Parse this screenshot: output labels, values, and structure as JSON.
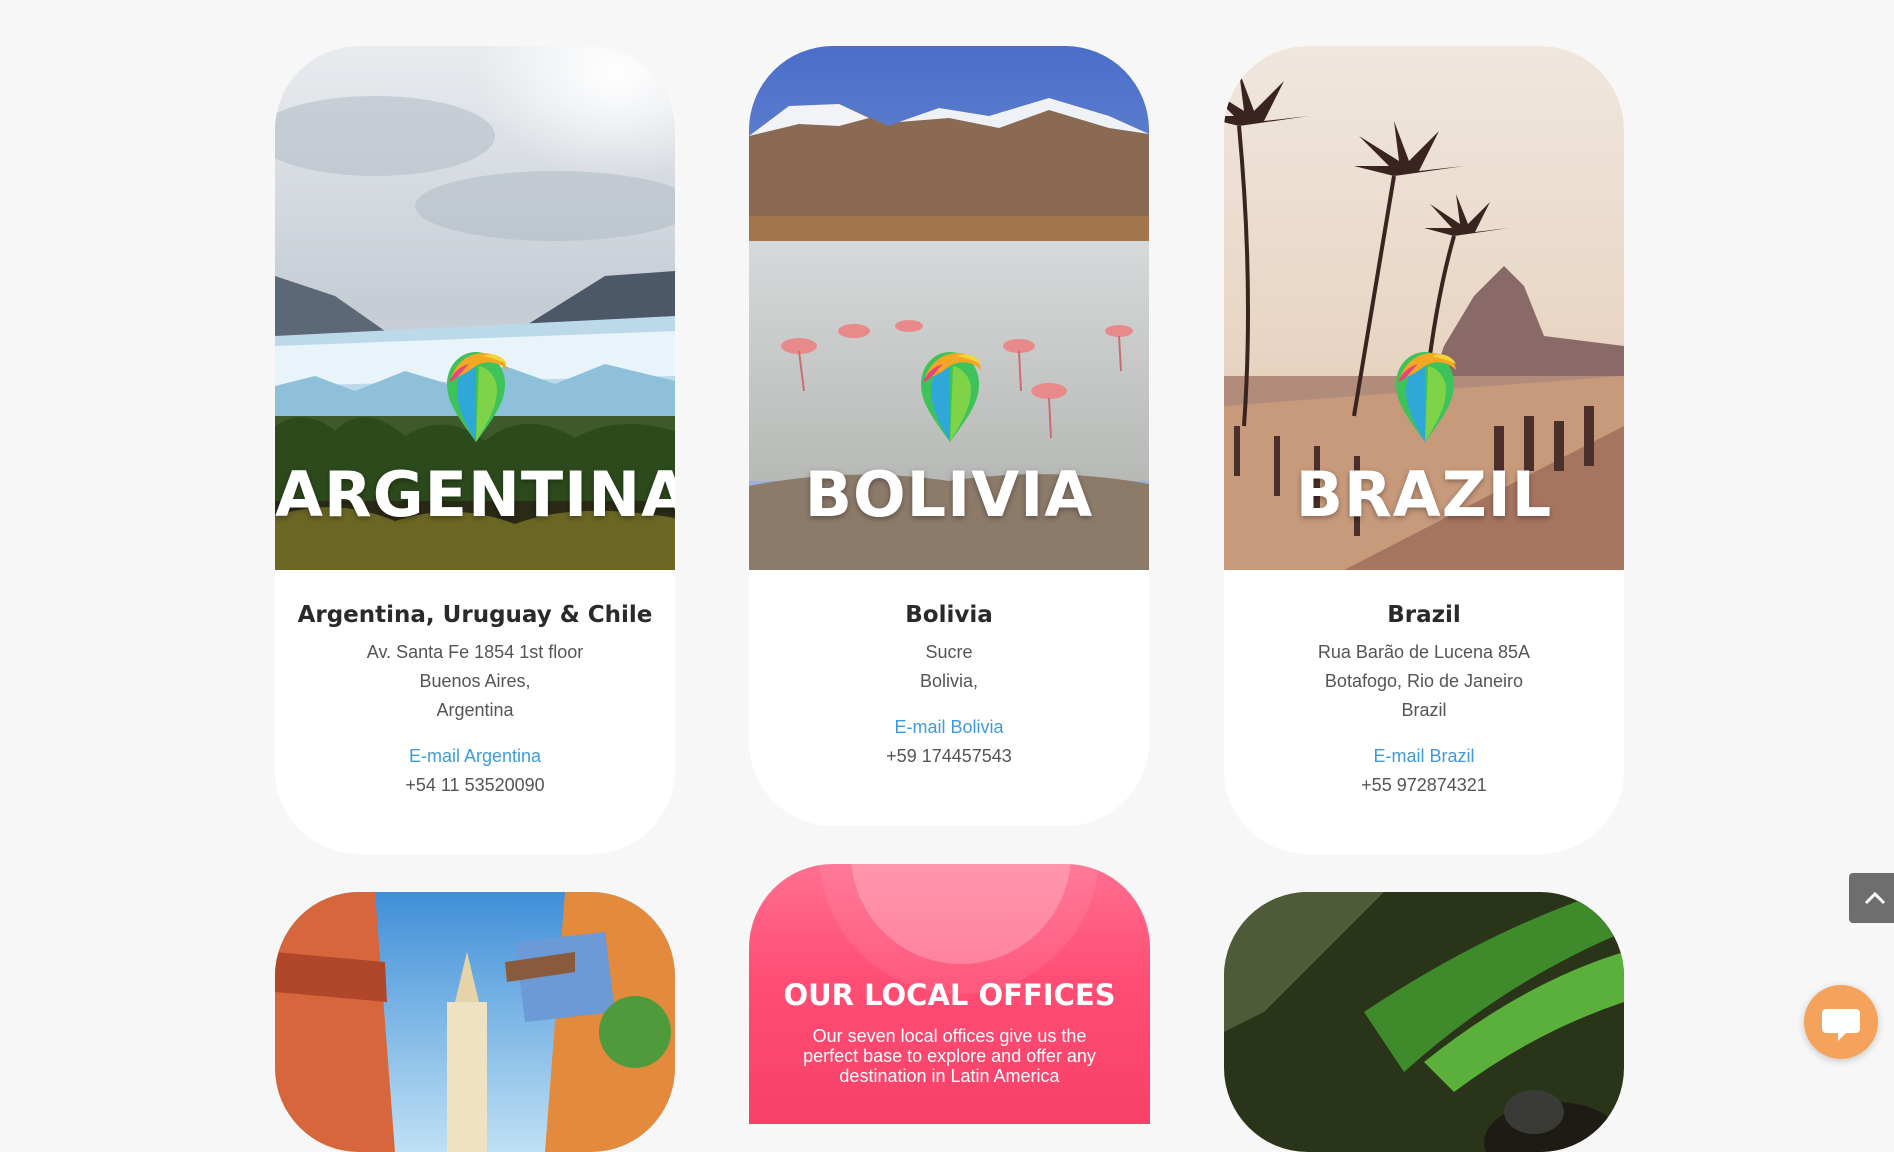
{
  "cards": [
    {
      "image_label": "ARGENTINA",
      "title": "Argentina, Uruguay & Chile",
      "address": [
        "Av. Santa Fe 1854 1st floor",
        "Buenos Aires,",
        "Argentina"
      ],
      "email_label": "E-mail Argentina",
      "phone": "+54 11 53520090"
    },
    {
      "image_label": "BOLIVIA",
      "title": "Bolivia",
      "address": [
        "Sucre",
        "Bolivia,"
      ],
      "email_label": "E-mail Bolivia",
      "phone": "+59 174457543"
    },
    {
      "image_label": "BRAZIL",
      "title": "Brazil",
      "address": [
        "Rua Barão de Lucena 85A",
        "Botafogo, Rio de Janeiro",
        "Brazil"
      ],
      "email_label": "E-mail Brazil",
      "phone": "+55 972874321"
    }
  ],
  "promo": {
    "title": "OUR LOCAL OFFICES",
    "text": "Our seven local offices give us the perfect base to explore and offer any destination in Latin America"
  },
  "icons": {
    "scroll_top": "chevron-up-icon",
    "chat": "chat-icon",
    "pin": "location-pin-icon"
  },
  "colors": {
    "link": "#3e9bdd",
    "promo": "#ff4d74",
    "chat": "#f5a25d"
  }
}
